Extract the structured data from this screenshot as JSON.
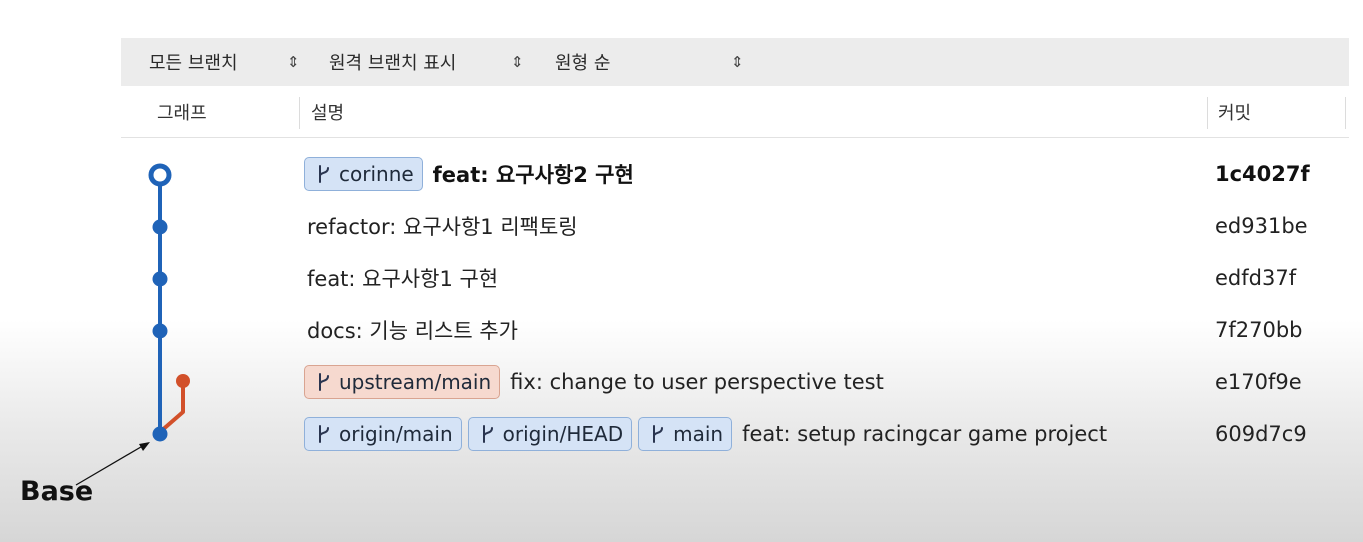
{
  "toolbar": {
    "branch_filter": "모든 브랜치",
    "remote_filter": "원격 브랜치 표시",
    "sort_order": "원형 순"
  },
  "columns": {
    "graph": "그래프",
    "description": "설명",
    "commit": "커밋"
  },
  "commits": [
    {
      "tags": [
        {
          "label": "corinne",
          "color": "#d5e3f6"
        }
      ],
      "message": "feat: 요구사항2 구현",
      "hash": "1c4027f",
      "bold": true
    },
    {
      "tags": [],
      "message": "refactor: 요구사항1 리팩토링",
      "hash": "ed931be"
    },
    {
      "tags": [],
      "message": "feat: 요구사항1 구현",
      "hash": "edfd37f"
    },
    {
      "tags": [],
      "message": "docs: 기능 리스트 추가",
      "hash": "7f270bb"
    },
    {
      "tags": [
        {
          "label": "upstream/main",
          "color": "#f6d9cf"
        }
      ],
      "message": "fix: change to user perspective test",
      "hash": "e170f9e"
    },
    {
      "tags": [
        {
          "label": "origin/main",
          "color": "#d5e3f6"
        },
        {
          "label": "origin/HEAD",
          "color": "#d5e3f6"
        },
        {
          "label": "main",
          "color": "#d5e3f6"
        }
      ],
      "message": "feat: setup racingcar game project",
      "hash": "609d7c9"
    }
  ],
  "graph_colors": {
    "main_line": "#1f63b8",
    "upstream_line": "#d2502a"
  },
  "annotation": {
    "label": "Base"
  }
}
